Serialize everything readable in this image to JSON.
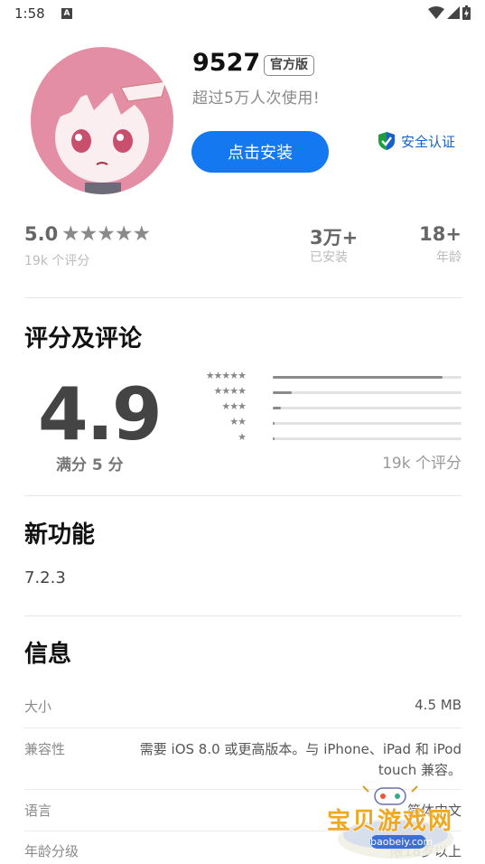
{
  "status": {
    "time": "1:58",
    "notif": "A"
  },
  "app": {
    "name": "9527",
    "badge": "官方版",
    "subtitle": "超过5万人次使用!",
    "install_label": "点击安装",
    "safe_label": "安全认证"
  },
  "stats": {
    "rating": "5.0",
    "stars": "★★★★★",
    "rating_sub": "19k 个评分",
    "installs": "3万+",
    "installs_sub": "已安装",
    "age": "18+",
    "age_sub": "年龄"
  },
  "reviews": {
    "title": "评分及评论",
    "score": "4.9",
    "out_of": "满分 5 分",
    "count": "19k 个评分",
    "histogram": [
      {
        "stars": "★★★★★",
        "fraction": 0.9
      },
      {
        "stars": "★★★★",
        "fraction": 0.1
      },
      {
        "stars": "★★★",
        "fraction": 0.045
      },
      {
        "stars": "★★",
        "fraction": 0.01
      },
      {
        "stars": "★",
        "fraction": 0.01
      }
    ]
  },
  "whats_new": {
    "title": "新功能",
    "version": "7.2.3"
  },
  "info": {
    "title": "信息",
    "rows": [
      {
        "label": "大小",
        "value": "4.5 MB"
      },
      {
        "label": "兼容性",
        "value": "需要 iOS 8.0 或更高版本。与 iPhone、iPad 和 iPod",
        "value2": "touch 兼容。"
      },
      {
        "label": "语言",
        "value": "简体中文"
      },
      {
        "label": "年龄分级",
        "value": "限18岁以上"
      }
    ]
  },
  "watermark": {
    "text": "宝贝游戏网",
    "url": "baobeiy.com"
  },
  "colors": {
    "accent": "#1478f0",
    "safe": "#1a5fc8",
    "shield": "#1a9f3a"
  }
}
